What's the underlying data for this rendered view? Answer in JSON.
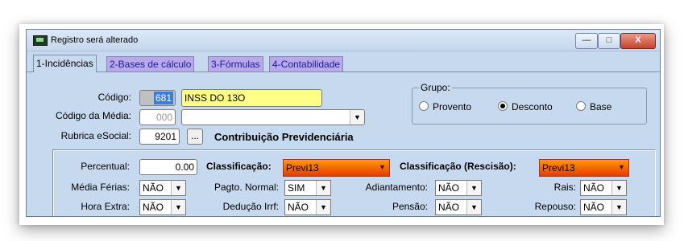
{
  "window": {
    "title": "Registro será alterado",
    "min_label": "—",
    "max_label": "□",
    "close_label": "X"
  },
  "tabs": [
    {
      "label": "1-Incidências",
      "active": true
    },
    {
      "label": "2-Bases de cálculo",
      "active": false
    },
    {
      "label": "3-Fórmulas",
      "active": false
    },
    {
      "label": "4-Contabilidade",
      "active": false
    }
  ],
  "form": {
    "codigo_label": "Código:",
    "codigo_value": "681",
    "descricao_value": "INSS DO 13O",
    "codigo_media_label": "Código da Média:",
    "codigo_media_value": "000",
    "codigo_media_select": "",
    "rubrica_label": "Rubrica eSocial:",
    "rubrica_value": "9201",
    "rubrica_button": "...",
    "rubrica_desc": "Contribuição Previdenciária"
  },
  "grupo": {
    "legend": "Grupo:",
    "options": [
      {
        "label": "Provento",
        "selected": false
      },
      {
        "label": "Desconto",
        "selected": true
      },
      {
        "label": "Base",
        "selected": false
      }
    ]
  },
  "details": {
    "percentual_label": "Percentual:",
    "percentual_value": "0.00",
    "classificacao_label": "Classificação:",
    "classificacao_value": "Previ13",
    "classificacao_rescisao_label": "Classificação (Rescisão):",
    "classificacao_rescisao_value": "Previ13",
    "media_ferias_label": "Média Férias:",
    "media_ferias_value": "NÃO",
    "pagto_normal_label": "Pagto. Normal:",
    "pagto_normal_value": "SIM",
    "adiantamento_label": "Adiantamento:",
    "adiantamento_value": "NÃO",
    "rais_label": "Rais:",
    "rais_value": "NÃO",
    "hora_extra_label": "Hora Extra:",
    "hora_extra_value": "NÃO",
    "deducao_irrf_label": "Dedução Irrf:",
    "deducao_irrf_value": "NÃO",
    "pensao_label": "Pensão:",
    "pensao_value": "NÃO",
    "repouso_label": "Repouso:",
    "repouso_value": "NÃO"
  },
  "colors": {
    "window_bg": "#c7d9ee",
    "tab_inactive": "#b9a9ea",
    "highlight_yellow": "#ffff88",
    "classification_orange": "#ff6a00",
    "close_red": "#c9422c"
  }
}
